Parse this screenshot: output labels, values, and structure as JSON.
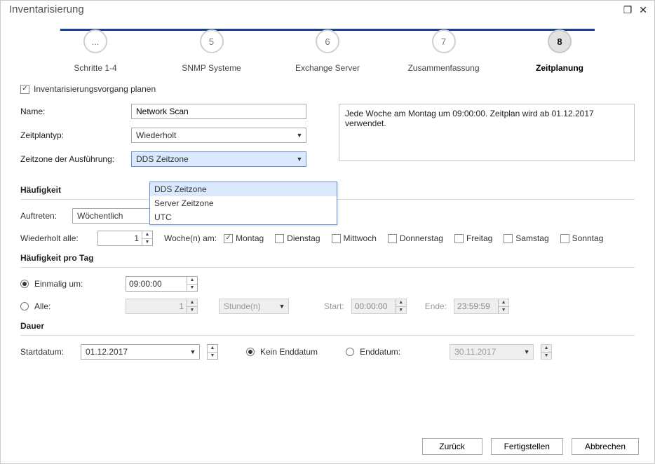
{
  "titlebar": {
    "title": "Inventarisierung"
  },
  "wizard": {
    "steps": [
      {
        "num": "...",
        "label": "Schritte 1-4"
      },
      {
        "num": "5",
        "label": "SNMP Systeme"
      },
      {
        "num": "6",
        "label": "Exchange Server"
      },
      {
        "num": "7",
        "label": "Zusammenfassung"
      },
      {
        "num": "8",
        "label": "Zeitplanung"
      }
    ],
    "active_index": 4
  },
  "plan": {
    "checkbox_label": "Inventarisierungsvorgang planen",
    "checked": true,
    "name_label": "Name:",
    "name_value": "Network Scan",
    "type_label": "Zeitplantyp:",
    "type_value": "Wiederholt",
    "tz_label": "Zeitzone der Ausführung:",
    "tz_value": "DDS Zeitzone",
    "tz_options": [
      "DDS Zeitzone",
      "Server Zeitzone",
      "UTC"
    ],
    "summary": "Jede Woche am Montag um 09:00:00. Zeitplan wird ab 01.12.2017 verwendet."
  },
  "freq": {
    "title": "Häufigkeit",
    "occur_label": "Auftreten:",
    "occur_value": "Wöchentlich",
    "repeat_label": "Wiederholt alle:",
    "repeat_value": "1",
    "weeks_on_label": "Woche(n) am:",
    "days": {
      "mon": {
        "label": "Montag",
        "checked": true
      },
      "tue": {
        "label": "Dienstag",
        "checked": false
      },
      "wed": {
        "label": "Mittwoch",
        "checked": false
      },
      "thu": {
        "label": "Donnerstag",
        "checked": false
      },
      "fri": {
        "label": "Freitag",
        "checked": false
      },
      "sat": {
        "label": "Samstag",
        "checked": false
      },
      "sun": {
        "label": "Sonntag",
        "checked": false
      }
    }
  },
  "perday": {
    "title": "Häufigkeit pro Tag",
    "once_label": "Einmalig um:",
    "once_value": "09:00:00",
    "every_label": "Alle:",
    "every_value": "1",
    "every_unit": "Stunde(n)",
    "start_label": "Start:",
    "start_value": "00:00:00",
    "end_label": "Ende:",
    "end_value": "23:59:59"
  },
  "duration": {
    "title": "Dauer",
    "start_label": "Startdatum:",
    "start_value": "01.12.2017",
    "noend_label": "Kein Enddatum",
    "end_label": "Enddatum:",
    "end_value": "30.11.2017"
  },
  "buttons": {
    "back": "Zurück",
    "finish": "Fertigstellen",
    "cancel": "Abbrechen"
  }
}
